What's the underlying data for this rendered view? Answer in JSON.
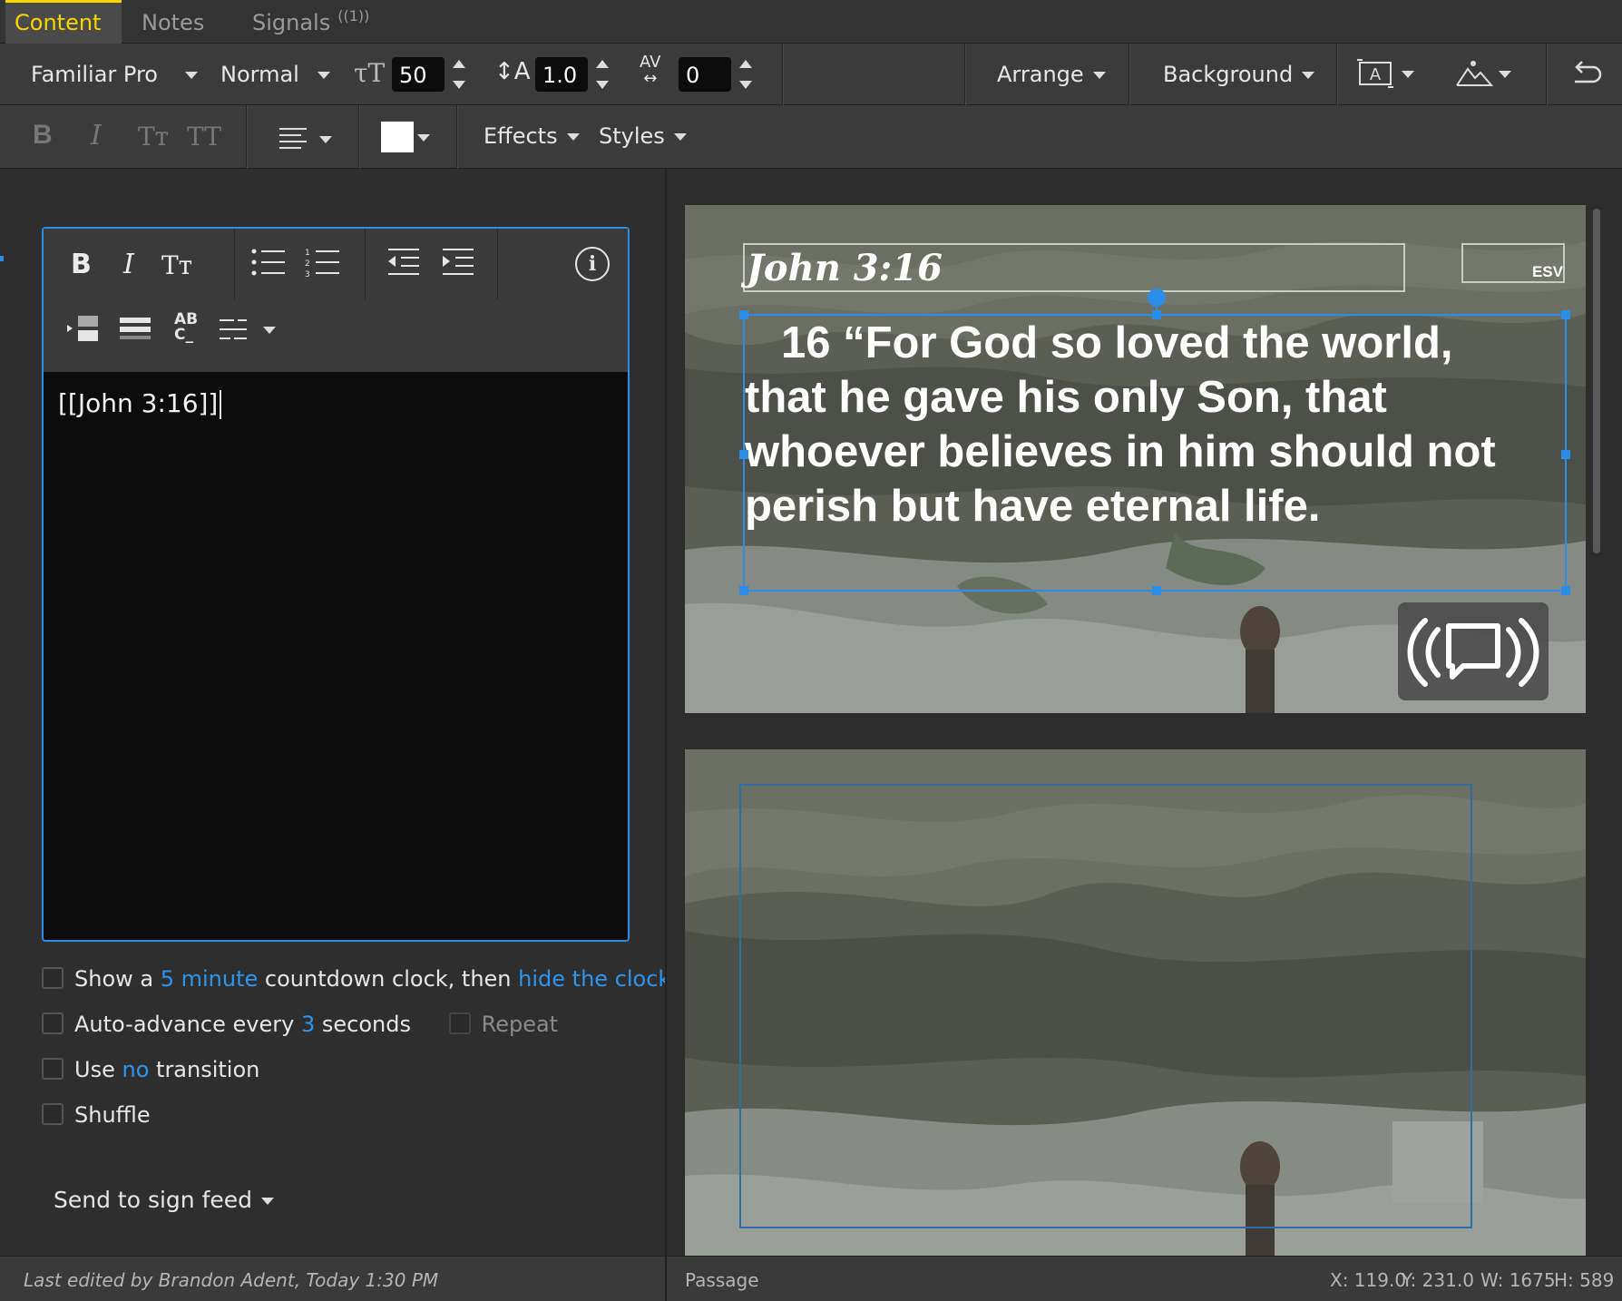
{
  "tabs": [
    {
      "label": "Content",
      "active": true
    },
    {
      "label": "Notes",
      "active": false
    },
    {
      "label": "Signals",
      "badge": "((1))",
      "active": false
    }
  ],
  "toolbar1": {
    "font_family": "Familiar Pro",
    "font_weight": "Normal",
    "font_size": "50",
    "line_height": "1.0",
    "letter_spacing": "0",
    "arrange": "Arrange",
    "background": "Background"
  },
  "toolbar2": {
    "bold": "B",
    "italic": "I",
    "small_caps": "Tт",
    "all_caps": "TT",
    "effects": "Effects",
    "styles": "Styles",
    "text_color": "#ffffff"
  },
  "editor": {
    "content": "[[John 3:16]]"
  },
  "options": {
    "countdown": {
      "prefix": "Show a",
      "minutes": "5 minute",
      "middle": "countdown clock, then",
      "action": "hide the clock"
    },
    "auto_advance": {
      "prefix": "Auto-advance every",
      "seconds": "3",
      "suffix": "seconds",
      "repeat": "Repeat"
    },
    "transition": {
      "prefix": "Use",
      "value": "no",
      "suffix": "transition"
    },
    "shuffle": "Shuffle",
    "send_to": "Send to sign feed"
  },
  "slide1": {
    "reference": "John 3:16",
    "version": "ESV",
    "verse": "16 “For God so loved the world, that he gave his only Son, that whoever believes in him should not perish but have eternal life."
  },
  "status": {
    "last_edited": "Last edited by Brandon Adent, Today 1:30 PM",
    "element_type": "Passage",
    "x": "X: 119.0",
    "y": "Y: 231.0",
    "w": "W: 1675",
    "h": "H: 589"
  },
  "colors": {
    "accent": "#f7d600",
    "selection": "#2b8de8",
    "link": "#2e95ee"
  }
}
